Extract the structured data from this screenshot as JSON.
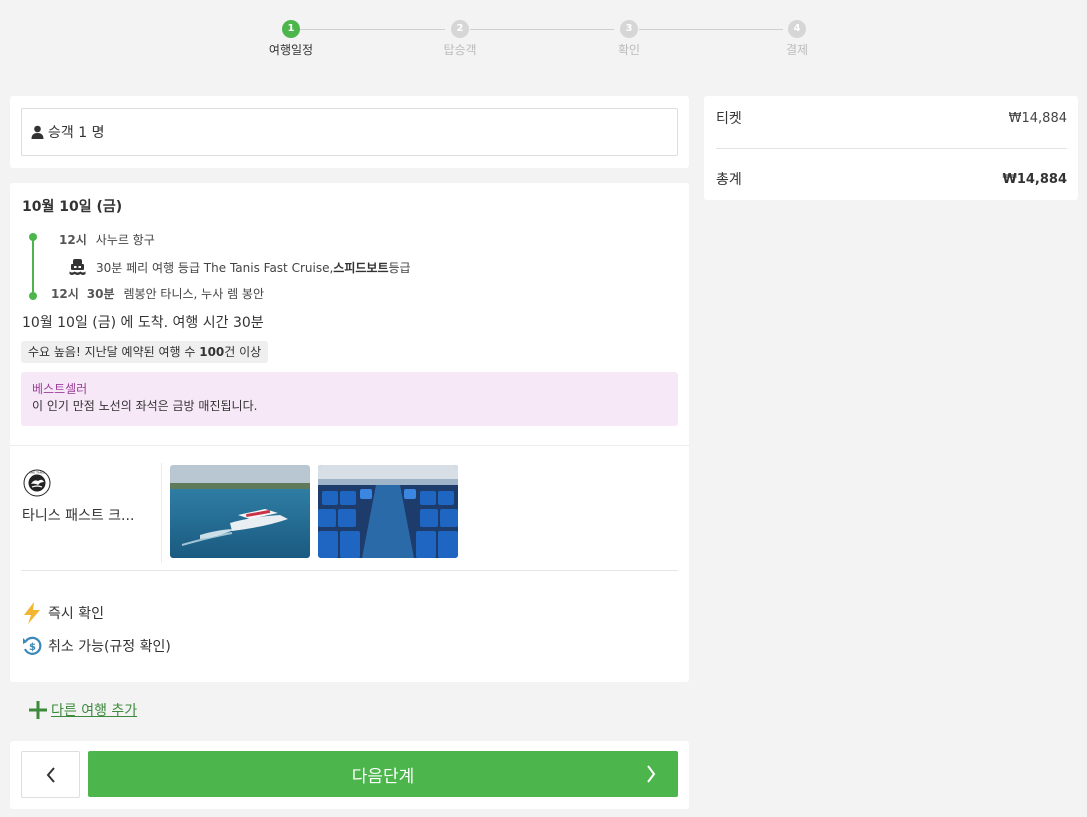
{
  "stepper": {
    "steps": [
      {
        "num": "1",
        "label": "여행일정",
        "state": "active"
      },
      {
        "num": "2",
        "label": "탑승객",
        "state": "inactive"
      },
      {
        "num": "3",
        "label": "확인",
        "state": "inactive"
      },
      {
        "num": "4",
        "label": "결제",
        "state": "inactive"
      }
    ]
  },
  "passenger": {
    "label": "승객 1 명",
    "icon": "person-icon"
  },
  "trip": {
    "date": "10월 10일 (금)",
    "departure": {
      "time": "12시",
      "place": "사누르 항구"
    },
    "vessel": {
      "text": "30분 페리 여행 등급 The Tanis Fast Cruise, ",
      "class_bold": "스피드보트",
      "class_suffix": " 등급",
      "icon": "ferry-icon"
    },
    "arrival": {
      "time_h": "12시",
      "time_m": "30분",
      "place": "렘봉안 타니스, 누사 렘 봉안"
    },
    "arrival_summary": "10월 10일 (금) 에 도착. 여행 시간 30분",
    "demand": {
      "prefix": "수요 높음! 지난달 예약된 여행 수 ",
      "count": "100",
      "suffix": "건 이상"
    },
    "bestseller": {
      "title": "베스트셀러",
      "desc": "이 인기 만점 노선의 좌석은 금방 매진됩니다."
    },
    "operator": {
      "name": "타니스 패스트 크...",
      "logo": "tanis-logo"
    },
    "photos": [
      "speedboat-photo",
      "boat-interior-photo"
    ],
    "features": [
      {
        "icon": "lightning-icon",
        "label": "즉시 확인",
        "color": "#f2b632"
      },
      {
        "icon": "refund-icon",
        "label": "취소 가능(규정 확인)",
        "color": "#3b87b8"
      }
    ]
  },
  "add_trip": {
    "label": "다른 여행 추가"
  },
  "navigation": {
    "next_label": "다음단계"
  },
  "summary": {
    "ticket_label": "티켓",
    "ticket_price": "₩14,884",
    "total_label": "총계",
    "total_price": "₩14,884"
  },
  "colors": {
    "accent": "#4cb64c",
    "bestseller_bg": "#f7e8f7",
    "bestseller_title": "#9a3f9a",
    "link": "#3c8a3c"
  }
}
